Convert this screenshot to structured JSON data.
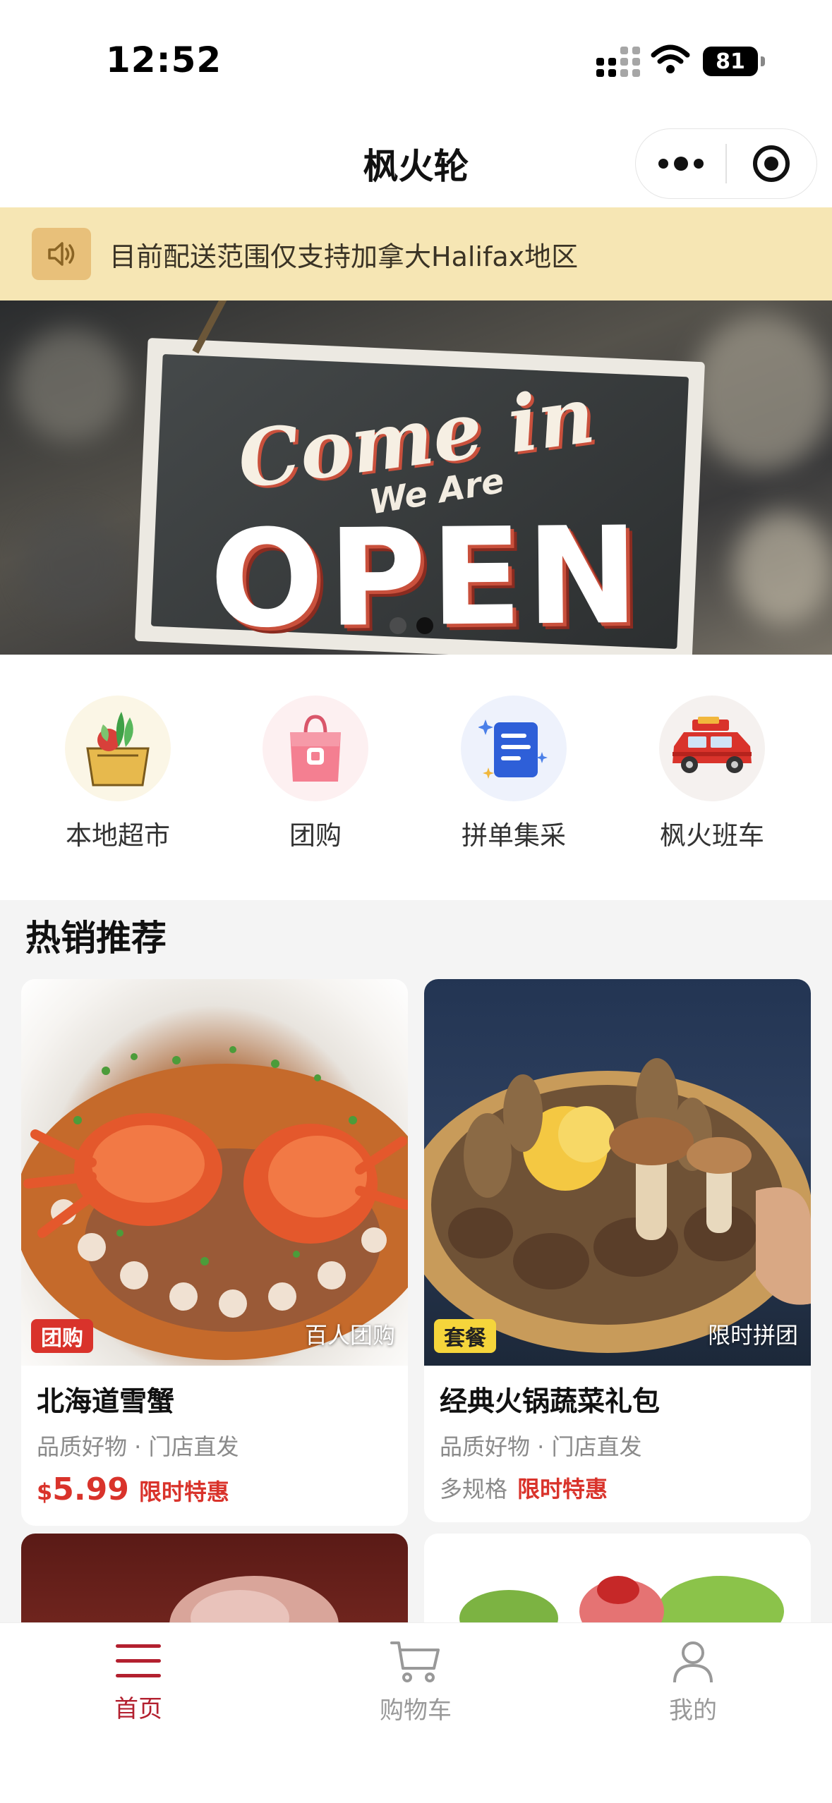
{
  "status_bar": {
    "time": "12:52",
    "battery": "81"
  },
  "nav": {
    "title": "枫火轮"
  },
  "notice": {
    "icon": "speaker-icon",
    "text": "目前配送范围仅支持加拿大Halifax地区"
  },
  "banner": {
    "sign_line1": "Come in",
    "sign_line2": "We Are",
    "sign_line3": "OPEN",
    "slides_count": 2,
    "active_slide": 2
  },
  "categories": [
    {
      "label": "本地超市",
      "icon": "grocery-bag-icon"
    },
    {
      "label": "团购",
      "icon": "shopping-bag-icon"
    },
    {
      "label": "拼单集采",
      "icon": "document-icon"
    },
    {
      "label": "枫火班车",
      "icon": "car-icon"
    }
  ],
  "hot": {
    "title": "热销推荐",
    "products": [
      {
        "tag": "团购",
        "caption": "百人团购",
        "name": "北海道雪蟹",
        "sub": "品质好物 · 门店直发",
        "currency": "$",
        "price": "5.99",
        "promo": "限时特惠"
      },
      {
        "tag": "套餐",
        "caption": "限时拼团",
        "name": "经典火锅蔬菜礼包",
        "sub": "品质好物 · 门店直发",
        "specs": "多规格",
        "promo": "限时特惠"
      }
    ]
  },
  "tabbar": {
    "items": [
      {
        "label": "首页",
        "icon": "menu-icon",
        "active": true
      },
      {
        "label": "购物车",
        "icon": "cart-icon",
        "active": false
      },
      {
        "label": "我的",
        "icon": "user-icon",
        "active": false
      }
    ]
  },
  "colors": {
    "accent": "#b3202f",
    "price_red": "#d9332b",
    "notice_bg": "#f6e6b4"
  }
}
